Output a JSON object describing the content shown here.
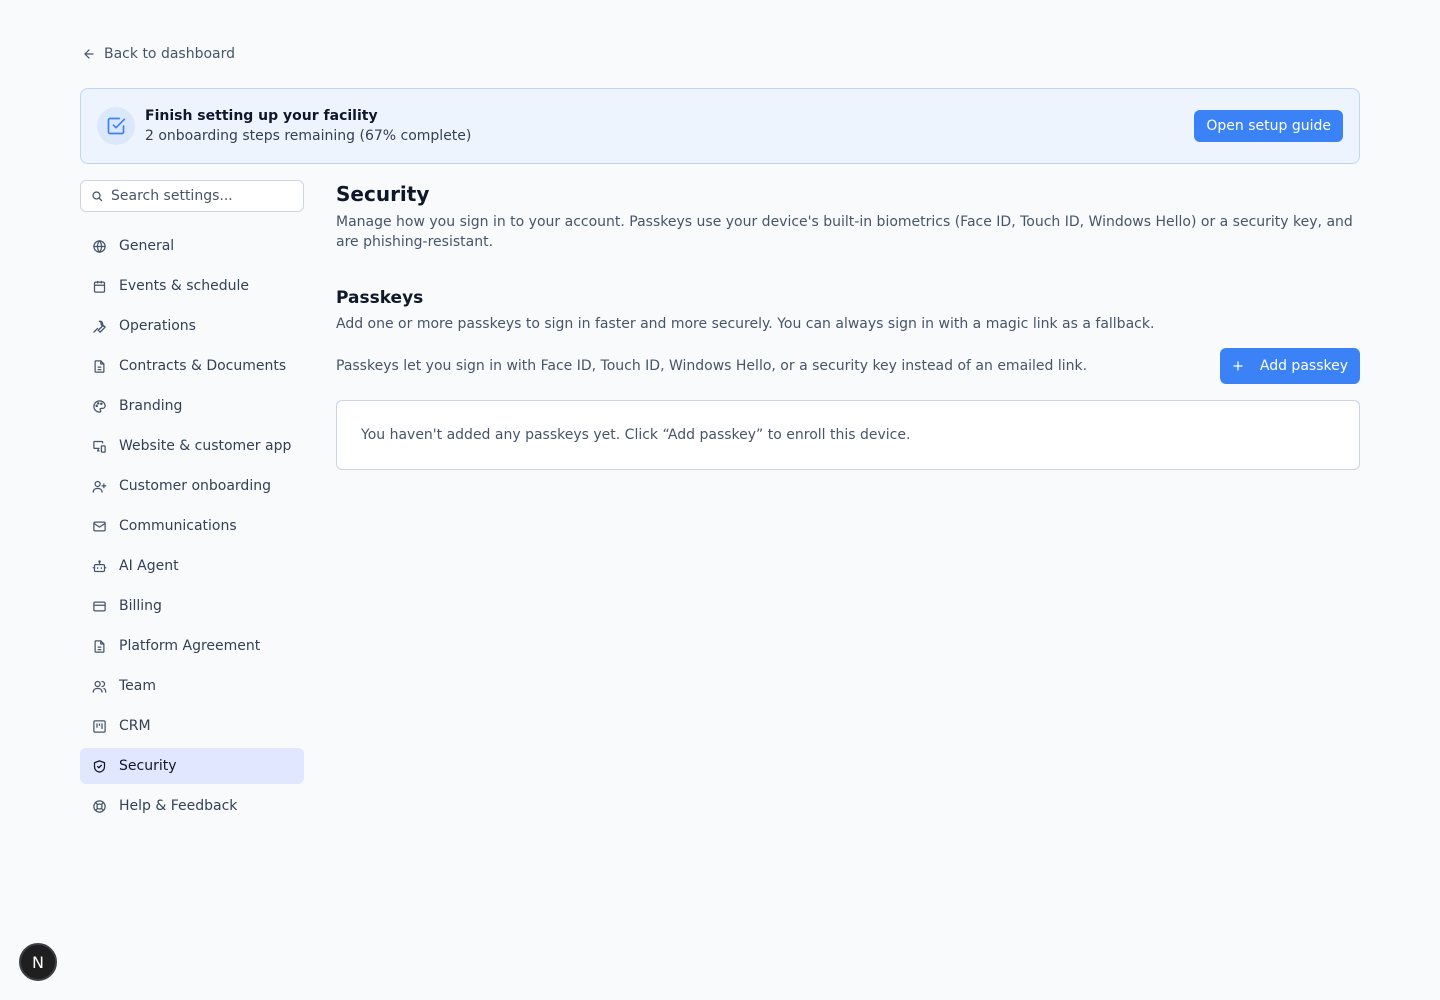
{
  "back_link": {
    "label": "Back to dashboard",
    "icon": "arrow-left-icon"
  },
  "banner": {
    "title": "Finish setting up your facility",
    "subtitle": "2 onboarding steps remaining (67% complete)",
    "button_label": "Open setup guide",
    "icon": "checkbox-icon"
  },
  "search": {
    "placeholder": "Search settings..."
  },
  "sidebar": {
    "items": [
      {
        "label": "General",
        "icon": "globe-icon",
        "active": false
      },
      {
        "label": "Events & schedule",
        "icon": "calendar-icon",
        "active": false
      },
      {
        "label": "Operations",
        "icon": "wrench-icon",
        "active": false
      },
      {
        "label": "Contracts & Documents",
        "icon": "document-icon",
        "active": false
      },
      {
        "label": "Branding",
        "icon": "palette-icon",
        "active": false
      },
      {
        "label": "Website & customer app",
        "icon": "devices-icon",
        "active": false
      },
      {
        "label": "Customer onboarding",
        "icon": "user-plus-icon",
        "active": false
      },
      {
        "label": "Communications",
        "icon": "mail-icon",
        "active": false
      },
      {
        "label": "AI Agent",
        "icon": "bot-icon",
        "active": false
      },
      {
        "label": "Billing",
        "icon": "credit-card-icon",
        "active": false
      },
      {
        "label": "Platform Agreement",
        "icon": "document-icon",
        "active": false
      },
      {
        "label": "Team",
        "icon": "users-icon",
        "active": false
      },
      {
        "label": "CRM",
        "icon": "kanban-icon",
        "active": false
      },
      {
        "label": "Security",
        "icon": "shield-icon",
        "active": true
      },
      {
        "label": "Help & Feedback",
        "icon": "lifebuoy-icon",
        "active": false
      }
    ]
  },
  "main": {
    "title": "Security",
    "description": "Manage how you sign in to your account. Passkeys use your device's built-in biometrics (Face ID, Touch ID, Windows Hello) or a security key, and are phishing-resistant.",
    "passkeys": {
      "title": "Passkeys",
      "description": "Add one or more passkeys to sign in faster and more securely. You can always sign in with a magic link as a fallback.",
      "info": "Passkeys let you sign in with Face ID, Touch ID, Windows Hello, or a security key instead of an emailed link.",
      "add_button_label": "Add passkey",
      "empty_message": "You haven't added any passkeys yet. Click “Add passkey” to enroll this device."
    }
  },
  "fab": {
    "label": "N"
  },
  "colors": {
    "accent": "#3b82f6",
    "active_nav": "#e0e7ff",
    "banner_bg": "#eef4fe",
    "page_bg": "#f8fafc"
  }
}
